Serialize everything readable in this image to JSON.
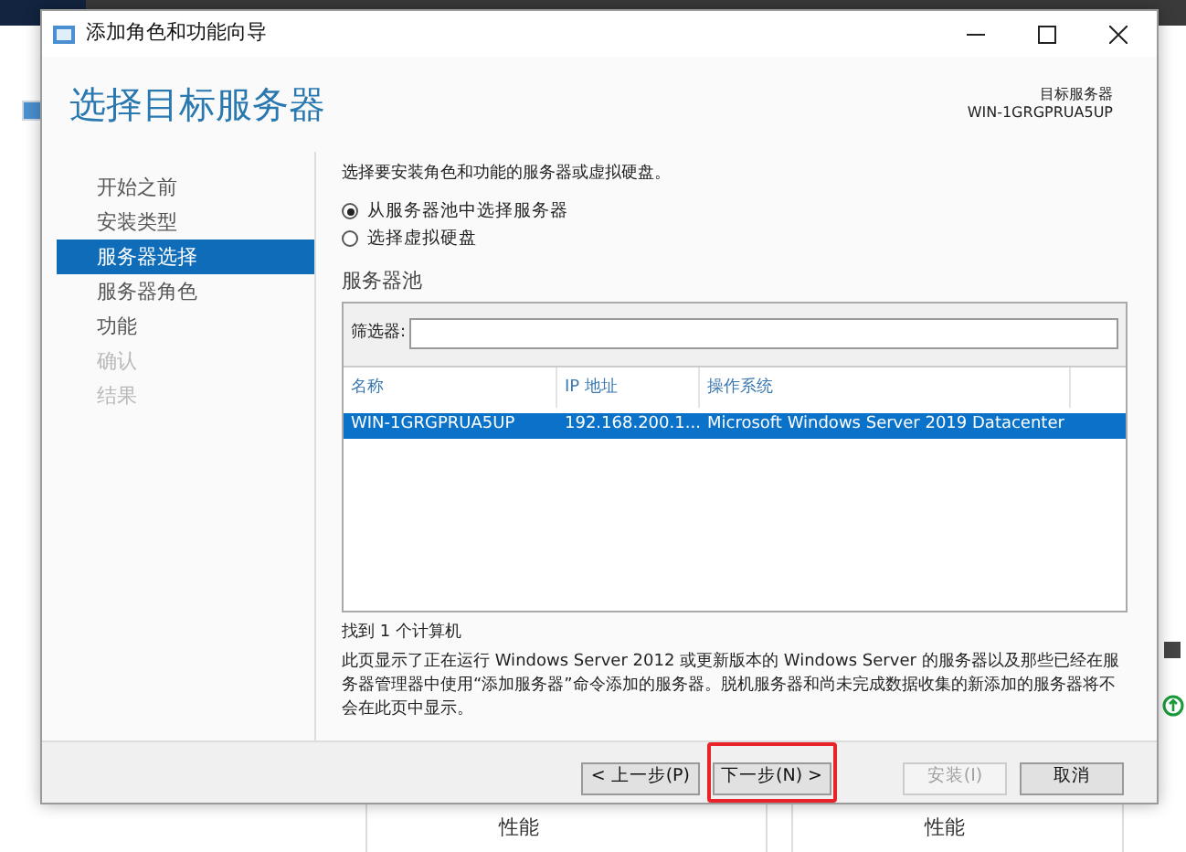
{
  "window": {
    "title": "添加角色和功能向导"
  },
  "header": {
    "title": "选择目标服务器",
    "target_label": "目标服务器",
    "target_value": "WIN-1GRGPRUA5UP"
  },
  "steps": [
    {
      "label": "开始之前",
      "selected": false,
      "disabled": false
    },
    {
      "label": "安装类型",
      "selected": false,
      "disabled": false
    },
    {
      "label": "服务器选择",
      "selected": true,
      "disabled": false
    },
    {
      "label": "服务器角色",
      "selected": false,
      "disabled": false
    },
    {
      "label": "功能",
      "selected": false,
      "disabled": false
    },
    {
      "label": "确认",
      "selected": false,
      "disabled": true
    },
    {
      "label": "结果",
      "selected": false,
      "disabled": true
    }
  ],
  "intro": "选择要安装角色和功能的服务器或虚拟硬盘。",
  "options": [
    {
      "label": "从服务器池中选择服务器",
      "selected": true
    },
    {
      "label": "选择虚拟硬盘",
      "selected": false
    }
  ],
  "pool": {
    "title": "服务器池",
    "filter_label": "筛选器:",
    "columns": [
      "名称",
      "IP 地址",
      "操作系统"
    ],
    "rows": [
      {
        "cells": [
          "WIN-1GRGPRUA5UP",
          "192.168.200.1...",
          "Microsoft Windows Server 2019 Datacenter"
        ],
        "selected": true
      }
    ]
  },
  "found": "找到 1 个计算机",
  "description": "此页显示了正在运行 Windows Server 2012 或更新版本的 Windows Server 的服务器以及那些已经在服务器管理器中使用“添加服务器”命令添加的服务器。脱机服务器和尚未完成数据收集的新添加的服务器将不会在此页中显示。",
  "buttons": [
    {
      "label": "< 上一步(P)",
      "disabled": false,
      "highlighted": false
    },
    {
      "label": "下一步(N) >",
      "disabled": false,
      "highlighted": true
    },
    {
      "label": "安装(I)",
      "disabled": true,
      "highlighted": false
    },
    {
      "label": "取消",
      "disabled": false,
      "highlighted": false
    }
  ],
  "background": {
    "panels": [
      "性能",
      "性能"
    ]
  }
}
